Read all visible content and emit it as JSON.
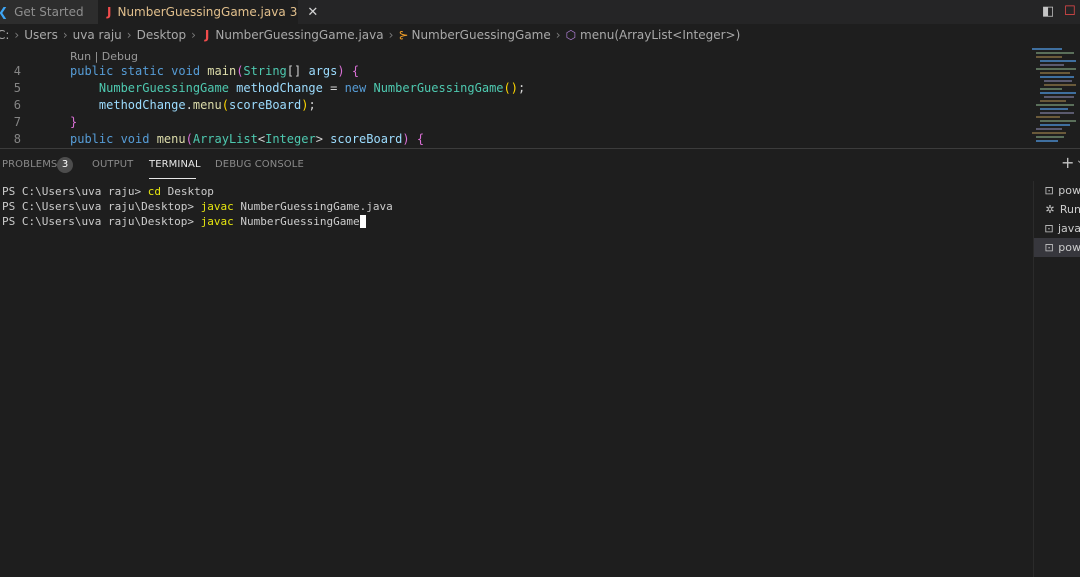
{
  "tabs": [
    {
      "label": "Get Started"
    },
    {
      "label": "NumberGuessingGame.java",
      "problems": "3"
    }
  ],
  "breadcrumb": {
    "root": "C:",
    "parts": [
      "Users",
      "uva raju",
      "Desktop"
    ],
    "file": "NumberGuessingGame.java",
    "class": "NumberGuessingGame",
    "method": "menu(ArrayList<Integer>)"
  },
  "editor": {
    "codelens": "Run | Debug",
    "lines": [
      {
        "n": "4"
      },
      {
        "n": "5"
      },
      {
        "n": "6"
      },
      {
        "n": "7"
      },
      {
        "n": "8"
      }
    ],
    "code": {
      "l4_kw": "public static void ",
      "l4_fn": "main",
      "l4_ty": "String",
      "l4_rest": "[] ",
      "l4_va": "args",
      "l5_ty": "NumberGuessingGame",
      "l5_va": " methodChange",
      "l5_eq": " = ",
      "l5_kw": "new ",
      "l5_ty2": "NumberGuessingGame",
      "l6_va": "methodChange",
      "l6_fn": "menu",
      "l6_arg": "scoreBoard",
      "l8_kw": "public void ",
      "l8_fn": "menu",
      "l8_ty": "ArrayList",
      "l8_ty2": "Integer",
      "l8_va": " scoreBoard"
    }
  },
  "panel": {
    "tabs": [
      "PROBLEMS",
      "OUTPUT",
      "TERMINAL",
      "DEBUG CONSOLE"
    ],
    "problem_count": "3",
    "active_tab": "TERMINAL"
  },
  "terminal": {
    "lines": [
      {
        "prompt": "PS C:\\Users\\uva raju> ",
        "cmd": "cd",
        "args": " Desktop"
      },
      {
        "prompt": "PS C:\\Users\\uva raju\\Desktop> ",
        "cmd": "javac",
        "args": " NumberGuessingGame.java"
      },
      {
        "prompt": "PS C:\\Users\\uva raju\\Desktop> ",
        "cmd": "javac",
        "args": " NumberGuessingGame"
      }
    ]
  },
  "terminal_list": [
    {
      "label": "pow",
      "icon": "terminal-icon"
    },
    {
      "label": "Run",
      "icon": "debug-icon"
    },
    {
      "label": "java",
      "icon": "terminal-icon"
    },
    {
      "label": "pow",
      "icon": "terminal-icon"
    }
  ],
  "colors": {
    "background": "#1e1e1e",
    "modified_tab": "#e2c08d",
    "keyword": "#569cd6",
    "type": "#4ec9b0",
    "function": "#dcdcaa",
    "variable": "#9cdcfe",
    "terminal_command": "#e5e510"
  }
}
